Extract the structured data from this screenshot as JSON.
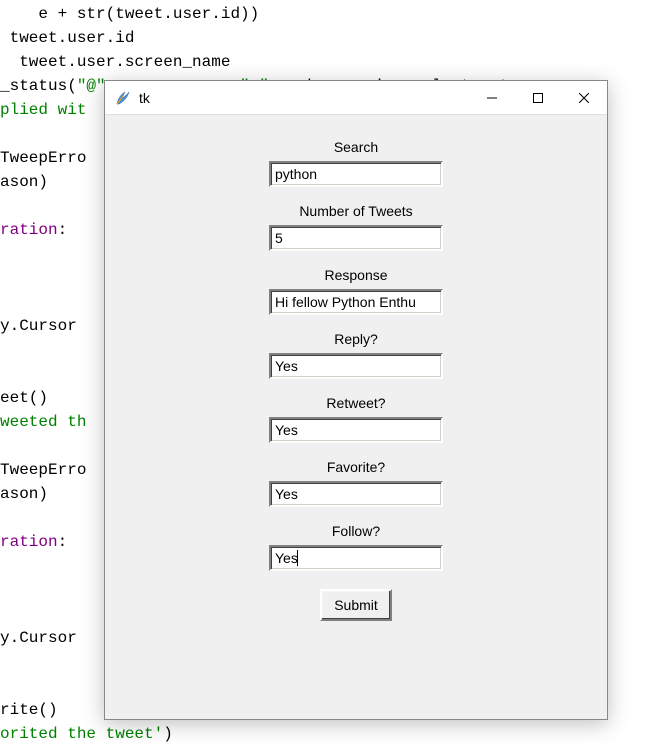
{
  "code": {
    "lines": [
      {
        "segments": [
          {
            "t": "    e",
            "c": "c-black"
          },
          {
            "t": " + str",
            "c": "c-black"
          },
          {
            "t": "(tweet.user.id))",
            "c": "c-black"
          }
        ]
      },
      {
        "segments": [
          {
            "t": " tweet.user.id",
            "c": "c-black"
          }
        ]
      },
      {
        "segments": [
          {
            "t": "  tweet.user.screen_name",
            "c": "c-black"
          }
        ]
      },
      {
        "segments": [
          {
            "t": "_status(",
            "c": "c-black"
          },
          {
            "t": "\"@\"",
            "c": "c-string"
          },
          {
            "t": " + username + ",
            "c": "c-black"
          },
          {
            "t": "\" \"",
            "c": "c-string"
          },
          {
            "t": " + phrase, in_reply_to_sta",
            "c": "c-black"
          }
        ]
      },
      {
        "segments": [
          {
            "t": "plied wit",
            "c": "c-string"
          }
        ]
      },
      {
        "segments": []
      },
      {
        "segments": [
          {
            "t": "TweepErro",
            "c": "c-black"
          }
        ]
      },
      {
        "segments": [
          {
            "t": "ason)",
            "c": "c-black"
          }
        ]
      },
      {
        "segments": []
      },
      {
        "segments": [
          {
            "t": "ration",
            "c": "c-purple"
          },
          {
            "t": ":",
            "c": "c-black"
          }
        ]
      },
      {
        "segments": []
      },
      {
        "segments": []
      },
      {
        "segments": []
      },
      {
        "segments": [
          {
            "t": "y.Cursor",
            "c": "c-black"
          }
        ]
      },
      {
        "segments": []
      },
      {
        "segments": []
      },
      {
        "segments": [
          {
            "t": "eet()",
            "c": "c-black"
          }
        ]
      },
      {
        "segments": [
          {
            "t": "weeted th",
            "c": "c-string"
          }
        ]
      },
      {
        "segments": []
      },
      {
        "segments": [
          {
            "t": "TweepErro",
            "c": "c-black"
          }
        ]
      },
      {
        "segments": [
          {
            "t": "ason)",
            "c": "c-black"
          }
        ]
      },
      {
        "segments": []
      },
      {
        "segments": [
          {
            "t": "ration",
            "c": "c-purple"
          },
          {
            "t": ":",
            "c": "c-black"
          }
        ]
      },
      {
        "segments": []
      },
      {
        "segments": []
      },
      {
        "segments": []
      },
      {
        "segments": [
          {
            "t": "y.Cursor",
            "c": "c-black"
          }
        ]
      },
      {
        "segments": []
      },
      {
        "segments": []
      },
      {
        "segments": [
          {
            "t": "rite()",
            "c": "c-black"
          }
        ]
      },
      {
        "segments": [
          {
            "t": "orited the tweet'",
            "c": "c-string"
          },
          {
            "t": ")",
            "c": "c-black"
          }
        ]
      }
    ]
  },
  "window": {
    "title": "tk",
    "submit_label": "Submit",
    "fields": [
      {
        "label": "Search",
        "value": "python",
        "cursor": false
      },
      {
        "label": "Number of Tweets",
        "value": "5",
        "cursor": false
      },
      {
        "label": "Response",
        "value": "Hi fellow Python Enthu",
        "cursor": false
      },
      {
        "label": "Reply?",
        "value": "Yes",
        "cursor": false
      },
      {
        "label": "Retweet?",
        "value": "Yes",
        "cursor": false
      },
      {
        "label": "Favorite?",
        "value": "Yes",
        "cursor": false
      },
      {
        "label": "Follow?",
        "value": "Yes",
        "cursor": true
      }
    ]
  }
}
